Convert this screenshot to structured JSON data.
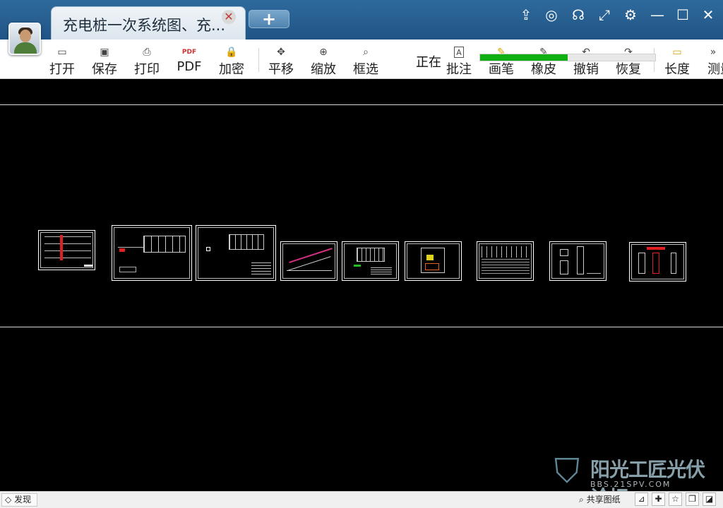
{
  "window": {
    "tab_title": "充电桩一次系统图、充...",
    "tab_close_glyph": "✕",
    "new_tab_glyph": "+",
    "controls": {
      "share": "⇪",
      "wechat": "◎",
      "support": "☊",
      "fullscreen": "⤢",
      "settings": "⚙",
      "minimize": "—",
      "maximize": "☐",
      "close": "✕"
    }
  },
  "toolbar": {
    "open": "打开",
    "save": "保存",
    "print": "打印",
    "pdf": "PDF",
    "encrypt": "加密",
    "pan": "平移",
    "zoom": "缩放",
    "box_select": "框选",
    "annotate": "批注",
    "pen": "画笔",
    "eraser": "橡皮",
    "undo": "撤销",
    "redo": "恢复",
    "length": "长度",
    "measure": "测量",
    "loading_text": "正在",
    "icons": {
      "open": "▭",
      "save": "▣",
      "print": "⎙",
      "pdf": "PDF",
      "encrypt": "🔒",
      "pan": "✥",
      "zoom": "⊕",
      "box_select": "⌕",
      "annotate": "A",
      "pen": "✎",
      "eraser": "✎",
      "undo": "↶",
      "redo": "↷",
      "length": "▭",
      "more": "»"
    }
  },
  "loading_progress": 0.5,
  "drawing": {
    "sheet_count": 9
  },
  "watermark": {
    "shield": "⛉",
    "title": "阳光工匠光伏论坛",
    "url": "BBS.21SPV.COM"
  },
  "statusbar": {
    "discover": "发现",
    "share_drawing": "共享图纸",
    "icons": {
      "discover": "◇",
      "search": "⌕",
      "layout": "⊿",
      "crosshair": "✚",
      "star": "☆",
      "layers": "❐",
      "fill": "◪"
    }
  }
}
